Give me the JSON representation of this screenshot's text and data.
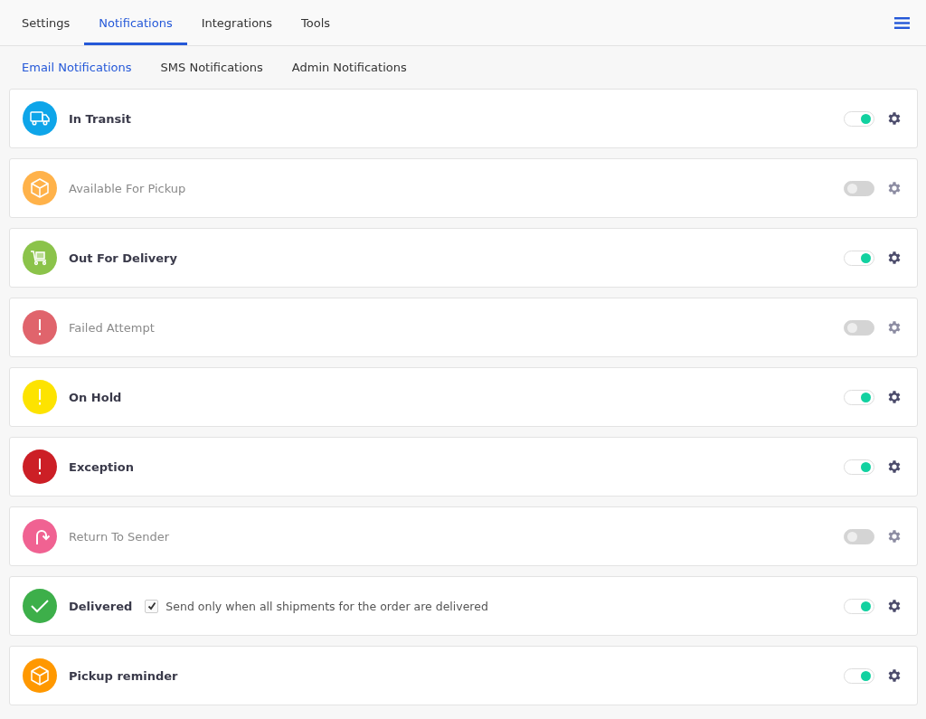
{
  "tabs": [
    {
      "label": "Settings",
      "selected": false
    },
    {
      "label": "Notifications",
      "selected": true
    },
    {
      "label": "Integrations",
      "selected": false
    },
    {
      "label": "Tools",
      "selected": false
    }
  ],
  "subtabs": [
    {
      "label": "Email Notifications",
      "selected": true
    },
    {
      "label": "SMS Notifications",
      "selected": false
    },
    {
      "label": "Admin Notifications",
      "selected": false
    }
  ],
  "notifications": [
    {
      "label": "In Transit",
      "kind": "truck",
      "color": "#0ea5e9",
      "on": true
    },
    {
      "label": "Available For Pickup",
      "kind": "box",
      "color": "#ffb24a",
      "on": false
    },
    {
      "label": "Out For Delivery",
      "kind": "cart",
      "color": "#8bc34a",
      "on": true
    },
    {
      "label": "Failed Attempt",
      "kind": "exclamation",
      "color": "#e0646c",
      "on": false
    },
    {
      "label": "On Hold",
      "kind": "exclamation",
      "color": "#fde300",
      "on": true
    },
    {
      "label": "Exception",
      "kind": "exclamation",
      "color": "#cc1f26",
      "on": true
    },
    {
      "label": "Return To Sender",
      "kind": "return",
      "color": "#f06292",
      "on": false
    },
    {
      "label": "Delivered",
      "kind": "check",
      "color": "#3daf4a",
      "on": true,
      "option": {
        "label": "Send only when all shipments for the order are delivered",
        "checked": true
      }
    },
    {
      "label": "Pickup reminder",
      "kind": "box",
      "color": "#ff9800",
      "on": true
    }
  ]
}
